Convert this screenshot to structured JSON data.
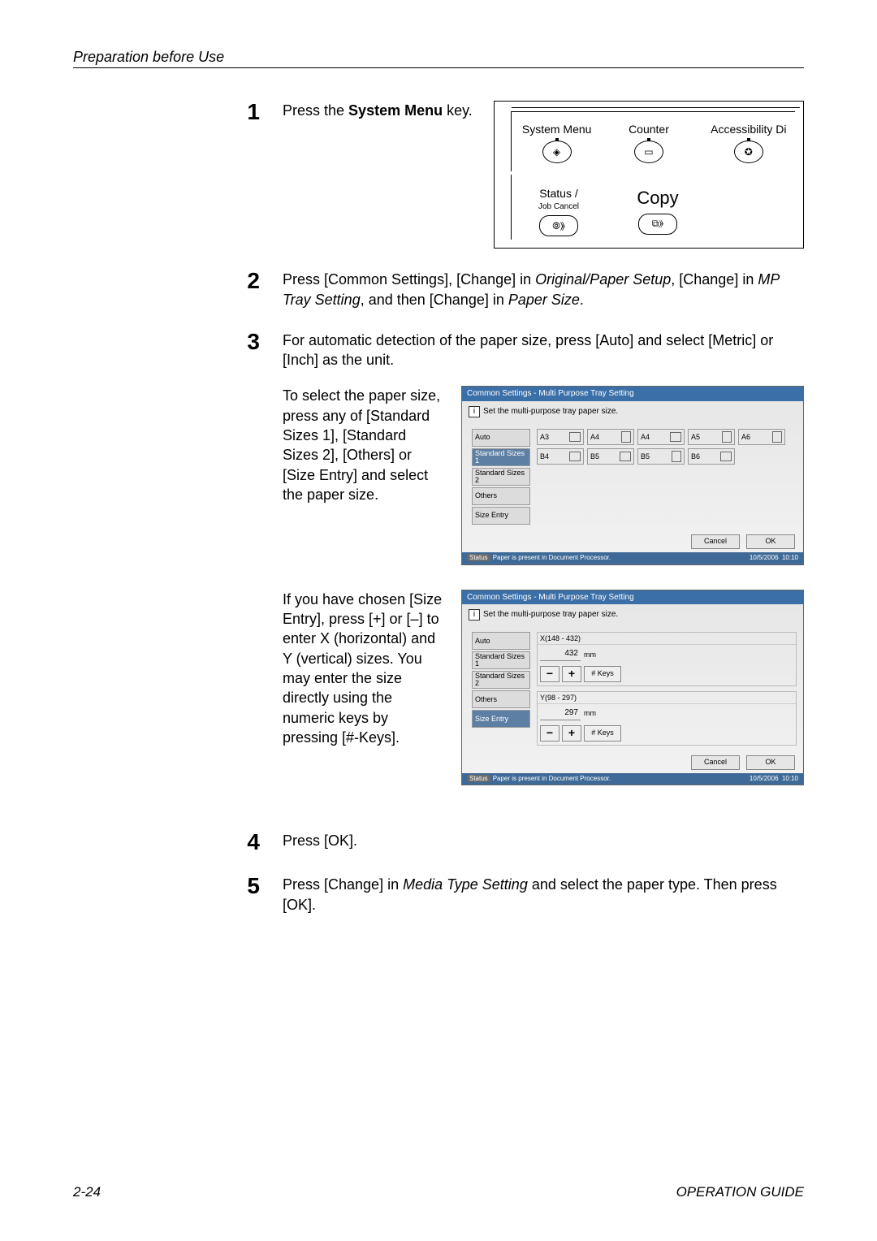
{
  "header": "Preparation before Use",
  "footer": {
    "page": "2-24",
    "guide": "OPERATION GUIDE"
  },
  "steps": {
    "n1": "1",
    "n2": "2",
    "n3": "3",
    "n4": "4",
    "n5": "5",
    "s1_a": "Press the ",
    "s1_b": "System Menu",
    "s1_c": " key.",
    "s2_a": "Press [Common Settings], [Change] in ",
    "s2_b": "Original/Paper Setup",
    "s2_c": ", [Change] in ",
    "s2_d": "MP Tray Setting",
    "s2_e": ", and then [Change] in ",
    "s2_f": "Paper Size",
    "s2_g": ".",
    "s3": "For automatic detection of the paper size, press [Auto] and select [Metric] or [Inch] as the unit.",
    "s3_side": "To select the paper size, press any of [Standard Sizes 1], [Standard Sizes 2], [Others] or [Size Entry] and select the paper size.",
    "s3_side2": "If you have chosen [Size Entry], press [+] or [–] to enter X (horizontal) and Y (vertical) sizes. You may enter the size directly using the numeric keys by pressing [#-Keys].",
    "s4": "Press [OK].",
    "s5_a": "Press [Change] in ",
    "s5_b": "Media Type Setting",
    "s5_c": " and select the paper type. Then press [OK]."
  },
  "panel": {
    "sysmenu": "System Menu",
    "counter": "Counter",
    "access": "Accessibility Di",
    "status": "Status /",
    "jobcancel": "Job Cancel",
    "copy": "Copy"
  },
  "screen1": {
    "title": "Common Settings - Multi Purpose Tray Setting",
    "msg": "Set the multi-purpose tray paper size.",
    "tabs": [
      "Auto",
      "Standard Sizes 1",
      "Standard Sizes 2",
      "Others",
      "Size Entry"
    ],
    "selectedTab": 1,
    "sizes": [
      "A3",
      "A4",
      "A4",
      "A5",
      "A6",
      "B4",
      "B5",
      "B5",
      "B6"
    ],
    "cancel": "Cancel",
    "ok": "OK",
    "status": "Status",
    "statusMsg": "Paper is present in Document Processor.",
    "date": "10/5/2006",
    "time": "10:10"
  },
  "screen2": {
    "title": "Common Settings - Multi Purpose Tray Setting",
    "msg": "Set the multi-purpose tray paper size.",
    "tabs": [
      "Auto",
      "Standard Sizes 1",
      "Standard Sizes 2",
      "Others",
      "Size Entry"
    ],
    "selectedTab": 4,
    "xLabel": "X(148 - 432)",
    "xVal": "432",
    "mm": "mm",
    "yLabel": "Y(98 - 297)",
    "yVal": "297",
    "minus": "−",
    "plus": "+",
    "keys": "# Keys",
    "cancel": "Cancel",
    "ok": "OK",
    "status": "Status",
    "statusMsg": "Paper is present in Document Processor.",
    "date": "10/5/2006",
    "time": "10:10"
  }
}
